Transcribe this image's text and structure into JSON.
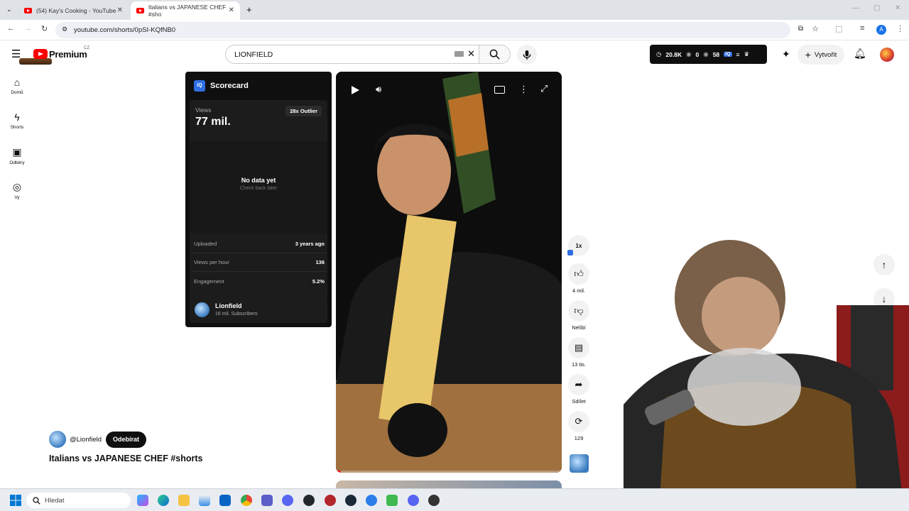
{
  "browser": {
    "tabs": [
      {
        "title": "(54) Kay's Cooking - YouTube"
      },
      {
        "title": "Italians vs JAPANESE CHEF #sho"
      }
    ],
    "url": "youtube.com/shorts/0pSI-KQfNB0",
    "profile_initial": "A"
  },
  "youtube": {
    "logo_text": "Premium",
    "region": "CZ",
    "search_value": "LIONFIELD",
    "create_label": "Vytvořit",
    "stats_bar": {
      "views": "20.8K",
      "a": "0",
      "b": "58"
    }
  },
  "nav": [
    {
      "label": "Domů",
      "icon": "home-icon"
    },
    {
      "label": "Shorts",
      "icon": "shorts-icon"
    },
    {
      "label": "Odběry",
      "icon": "subscriptions-icon"
    },
    {
      "label": "Vy",
      "icon": "you-icon"
    }
  ],
  "scorecard": {
    "logo": "iQ",
    "title": "Scorecard",
    "views_label": "Views",
    "views_value": "77 mil.",
    "outlier_badge": "28x Outlier",
    "empty_title": "No data yet",
    "empty_sub": "Check back later",
    "rows": [
      {
        "label": "Uploaded",
        "value": "3 years ago"
      },
      {
        "label": "Views per hour",
        "value": "136"
      },
      {
        "label": "Engagement",
        "value": "5.2%"
      }
    ],
    "channel_name": "Lionfield",
    "channel_subs": "16 mil. Subscribers"
  },
  "video": {
    "channel_handle": "@Lionfield",
    "subscribe_label": "Odebírat",
    "title": "Italians vs JAPANESE CHEF #shorts",
    "progress": 0.02
  },
  "actions": {
    "speed": "1x",
    "likes": "4 mil.",
    "dislike_label": "Nelíbí",
    "comments": "13 tis.",
    "share_label": "Sdílet",
    "remix": "129"
  },
  "taskbar": {
    "search_placeholder": "Hledat"
  },
  "colors": {
    "yt_red": "#ff0000",
    "dark": "#0f0f0f",
    "taskbar": "#e9edf2"
  }
}
